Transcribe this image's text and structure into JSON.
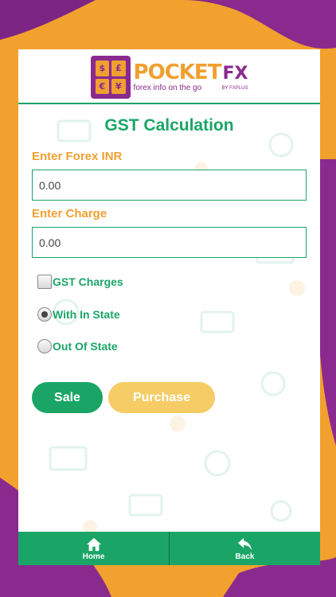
{
  "app": {
    "logo": {
      "brand": "POCKET",
      "brand_accent": "FX",
      "by": "BY FXPLUS",
      "tagline": "forex info on the go",
      "badge_symbols": [
        "$",
        "£",
        "€",
        "¥"
      ]
    }
  },
  "page": {
    "title": "GST Calculation"
  },
  "form": {
    "forex_label": "Enter Forex INR",
    "forex_value": "0.00",
    "charge_label": "Enter Charge",
    "charge_value": "0.00"
  },
  "options": {
    "gst_charges": {
      "label": "GST Charges",
      "checked": false
    },
    "with_in_state": {
      "label": "With In State",
      "selected": true
    },
    "out_of_state": {
      "label": "Out Of State",
      "selected": false
    }
  },
  "buttons": {
    "sale": "Sale",
    "purchase": "Purchase"
  },
  "footer": {
    "home": "Home",
    "back": "Back"
  },
  "colors": {
    "primary_green": "#1aa567",
    "accent_orange": "#f0a030",
    "brand_purple": "#8a2a8e",
    "purchase_yellow": "#f5cc66"
  }
}
